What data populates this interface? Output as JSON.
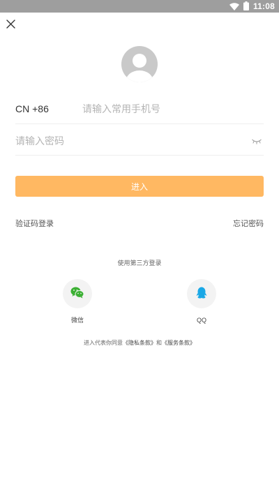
{
  "status_bar": {
    "time": "11:08",
    "wifi_icon": "wifi-icon",
    "battery_icon": "battery-icon"
  },
  "header": {
    "close_icon": "close-icon"
  },
  "avatar": {
    "icon": "default-avatar-icon"
  },
  "phone": {
    "country_code": "CN +86",
    "placeholder": "请输入常用手机号",
    "value": ""
  },
  "password": {
    "placeholder": "请输入密码",
    "value": "",
    "toggle_icon": "eye-closed-icon"
  },
  "submit": {
    "label": "进入"
  },
  "links": {
    "sms_login": "验证码登录",
    "forgot_password": "忘记密码"
  },
  "third_party": {
    "title": "使用第三方登录",
    "wechat_label": "微信",
    "qq_label": "QQ",
    "wechat_icon": "wechat-icon",
    "qq_icon": "qq-icon"
  },
  "agreement": {
    "prefix": "进入代表你同意",
    "privacy": "《隐私条款》",
    "and": "和",
    "service": "《服务条款》"
  },
  "colors": {
    "status_bar": "#9e9e9e",
    "primary_button": "#ffb862",
    "wechat_green": "#3cb034",
    "qq_blue": "#1aa8e6",
    "avatar_gray": "#c9c9c9"
  }
}
